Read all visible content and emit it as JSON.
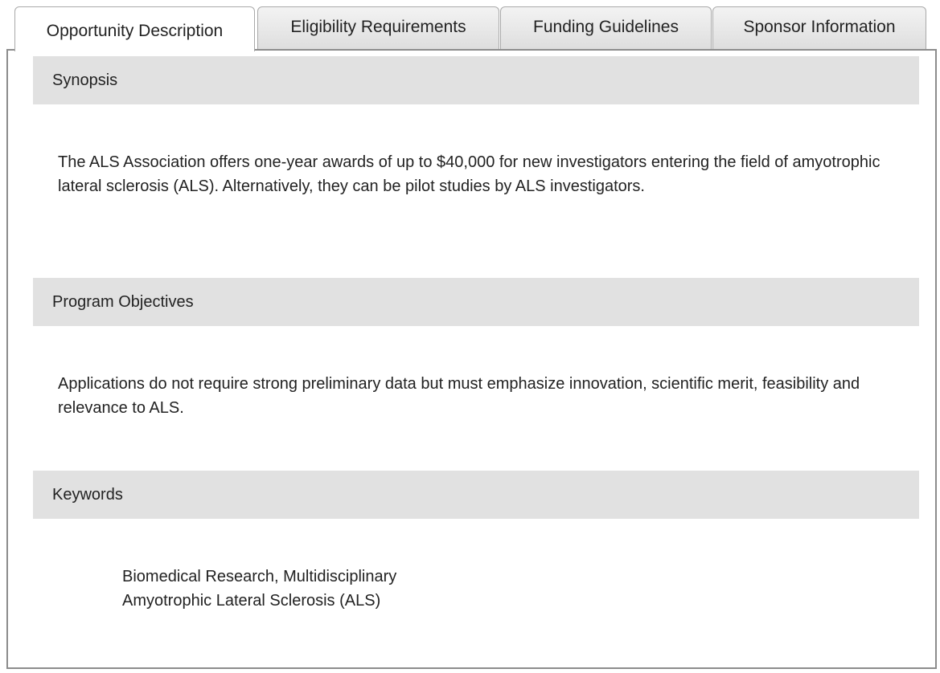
{
  "tabs": [
    {
      "label": "Opportunity Description",
      "active": true
    },
    {
      "label": "Eligibility Requirements",
      "active": false
    },
    {
      "label": "Funding Guidelines",
      "active": false
    },
    {
      "label": "Sponsor Information",
      "active": false
    }
  ],
  "sections": {
    "synopsis": {
      "title": "Synopsis",
      "body": "The ALS Association offers one-year awards of up to $40,000 for new investigators entering the field of amyotrophic lateral sclerosis (ALS). Alternatively, they can be pilot studies by ALS investigators."
    },
    "objectives": {
      "title": "Program Objectives",
      "body": "Applications do not require strong preliminary data but must emphasize innovation, scientific merit, feasibility and relevance to ALS."
    },
    "keywords": {
      "title": "Keywords",
      "items": [
        "Biomedical Research, Multidisciplinary",
        "Amyotrophic Lateral Sclerosis (ALS)"
      ]
    }
  }
}
